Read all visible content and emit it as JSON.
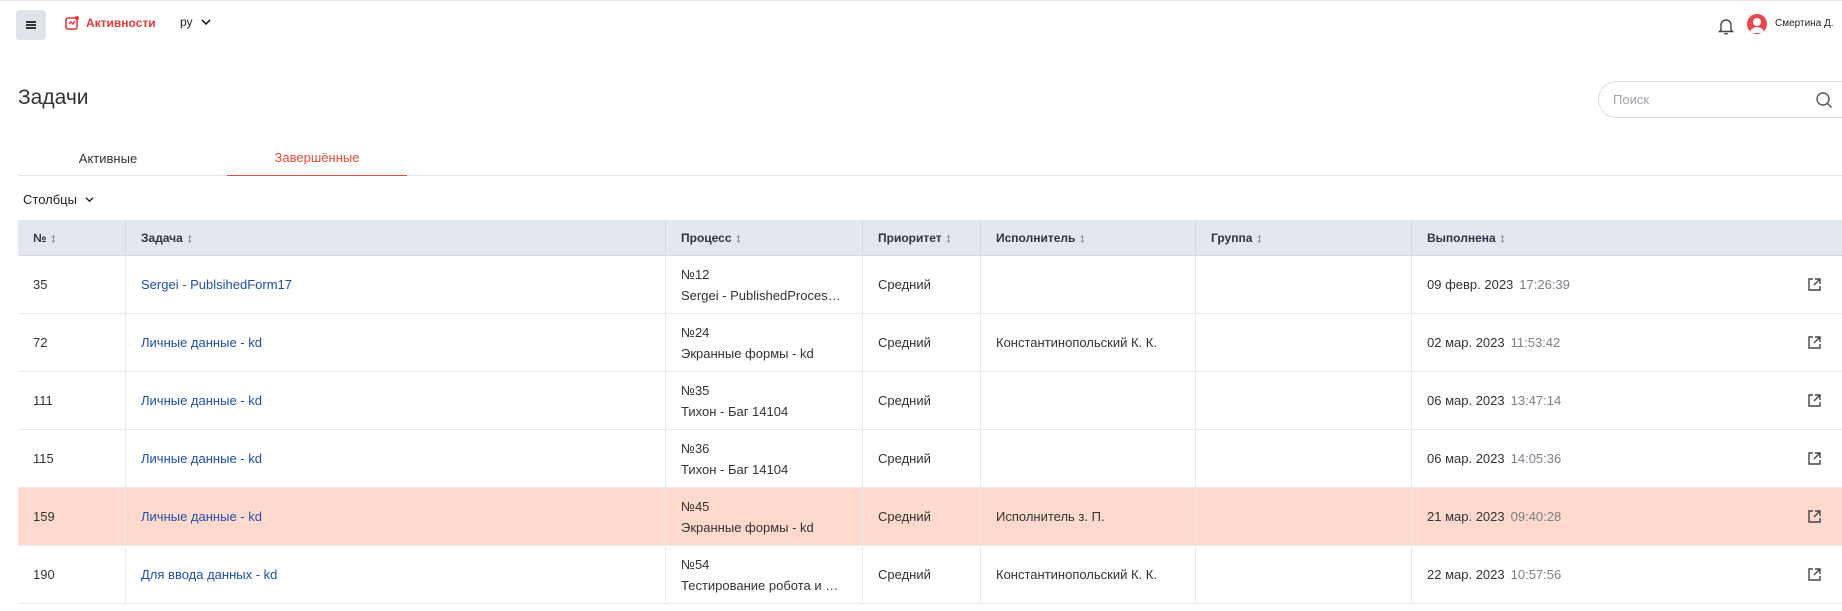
{
  "topbar": {
    "brand_label": "Активности",
    "lang_label": "ру",
    "user_name": "Смертина Д."
  },
  "header": {
    "title": "Задачи",
    "search_placeholder": "Поиск"
  },
  "tabs": [
    {
      "label": "Активные",
      "active": false
    },
    {
      "label": "Завершённые",
      "active": true
    }
  ],
  "columns_button": "Столбцы",
  "table": {
    "headers": [
      "№",
      "Задача",
      "Процесс",
      "Приоритет",
      "Исполнитель",
      "Группа",
      "Выполнена"
    ],
    "sort_glyph": "↕",
    "rows": [
      {
        "num": "35",
        "task": "Sergei - PublsihedForm17",
        "proc_no": "№12",
        "proc_name": "Sergei - PublishedProcess...",
        "priority": "Средний",
        "assignee": "",
        "group": "",
        "date": "09 февр. 2023",
        "time": "17:26:39",
        "highlight": false
      },
      {
        "num": "72",
        "task": "Личные данные - kd",
        "proc_no": "№24",
        "proc_name": "Экранные формы - kd",
        "priority": "Средний",
        "assignee": "Константинопольский К. К.",
        "group": "",
        "date": "02 мар. 2023",
        "time": "11:53:42",
        "highlight": false
      },
      {
        "num": "111",
        "task": "Личные данные - kd",
        "proc_no": "№35",
        "proc_name": "Тихон - Баг 14104",
        "priority": "Средний",
        "assignee": "",
        "group": "",
        "date": "06 мар. 2023",
        "time": "13:47:14",
        "highlight": false
      },
      {
        "num": "115",
        "task": "Личные данные - kd",
        "proc_no": "№36",
        "proc_name": "Тихон - Баг 14104",
        "priority": "Средний",
        "assignee": "",
        "group": "",
        "date": "06 мар. 2023",
        "time": "14:05:36",
        "highlight": false
      },
      {
        "num": "159",
        "task": "Личные данные - kd",
        "proc_no": "№45",
        "proc_name": "Экранные формы - kd",
        "priority": "Средний",
        "assignee": "Исполнитель з. П.",
        "group": "",
        "date": "21 мар. 2023",
        "time": "09:40:28",
        "highlight": true
      },
      {
        "num": "190",
        "task": "Для ввода данных - kd",
        "proc_no": "№54",
        "proc_name": "Тестирование робота и ф...",
        "priority": "Средний",
        "assignee": "Константинопольский К. К.",
        "group": "",
        "date": "22 мар. 2023",
        "time": "10:57:56",
        "highlight": false
      }
    ]
  },
  "colors": {
    "accent": "#e84a3c",
    "link": "#1f4fa8",
    "header_bg": "#e3e7ef",
    "highlight_row": "#ffd9cd"
  }
}
